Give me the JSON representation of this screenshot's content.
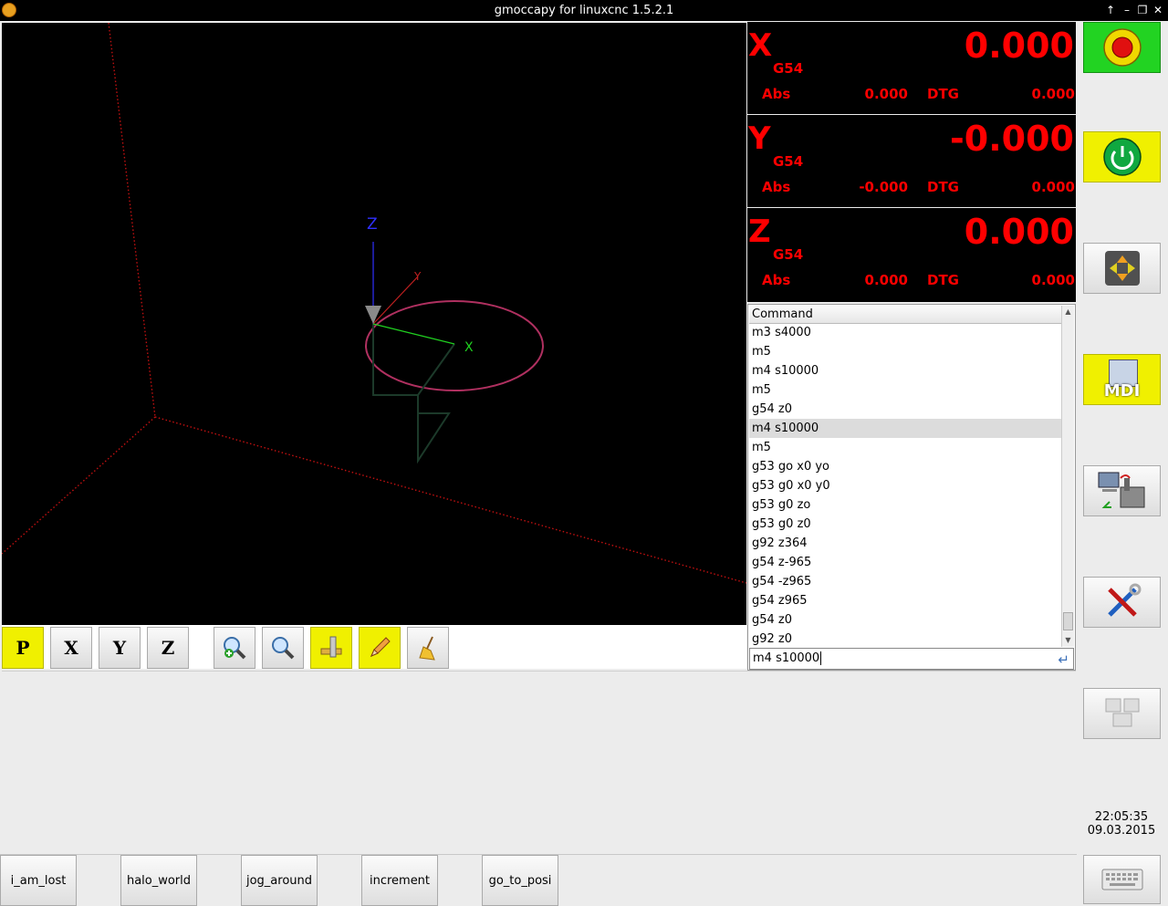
{
  "window": {
    "title": "gmoccapy for linuxcnc   1.5.2.1"
  },
  "preview": {
    "axis_labels": {
      "x": "X",
      "y": "Y",
      "z": "Z"
    }
  },
  "preview_toolbar": {
    "view_p": "P",
    "view_x": "X",
    "view_y": "Y",
    "view_z": "Z"
  },
  "dro": [
    {
      "axis": "X",
      "coord_system": "G54",
      "value": "0.000",
      "abs_label": "Abs",
      "abs": "0.000",
      "dtg_label": "DTG",
      "dtg": "0.000"
    },
    {
      "axis": "Y",
      "coord_system": "G54",
      "value": "-0.000",
      "abs_label": "Abs",
      "abs": "-0.000",
      "dtg_label": "DTG",
      "dtg": "0.000"
    },
    {
      "axis": "Z",
      "coord_system": "G54",
      "value": "0.000",
      "abs_label": "Abs",
      "abs": "0.000",
      "dtg_label": "DTG",
      "dtg": "0.000"
    }
  ],
  "command": {
    "header": "Command",
    "history": [
      "m3 s4000",
      "m5",
      "m4 s10000",
      "m5",
      "g54 z0",
      "m4 s10000",
      "m5",
      "g53 go x0 yo",
      "g53 g0 x0 y0",
      "g53 g0 zo",
      "g53 g0 z0",
      "g92 z364",
      "g54 z-965",
      "g54 -z965",
      "g54 z965",
      "g54 z0",
      "g92 z0"
    ],
    "selected_index": 5,
    "input_value": "m4 s10000"
  },
  "side": {
    "estop_label": "Emergency Stop",
    "mdi_label": "MDI"
  },
  "clock": {
    "time": "22:05:35",
    "date": "09.03.2015"
  },
  "macros": [
    "i_am_lost",
    "halo_world",
    "jog_around",
    "increment",
    "go_to_posi"
  ],
  "colors": {
    "dro_text": "#ff0000",
    "estop_bg": "#22d322",
    "active_yellow": "#f0f000"
  }
}
